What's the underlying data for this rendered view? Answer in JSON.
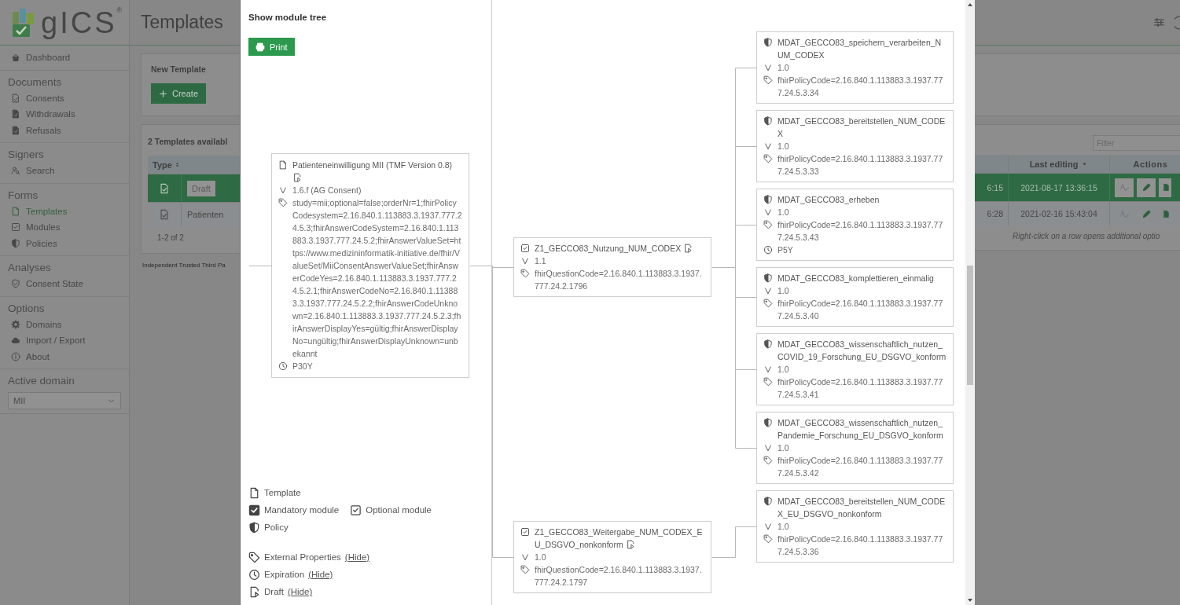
{
  "app": {
    "logo": "gICS$^{®}$",
    "page_title": "Templates"
  },
  "sidebar": {
    "sections": [
      {
        "items": [
          {
            "label": "Dashboard",
            "selected": false
          }
        ]
      },
      {
        "heading": "Documents",
        "items": [
          {
            "label": "Consents",
            "selected": false
          },
          {
            "label": "Withdrawals",
            "selected": false
          },
          {
            "label": "Refusals",
            "selected": false
          }
        ]
      },
      {
        "heading": "Signers",
        "items": [
          {
            "label": "Search",
            "selected": false
          }
        ]
      },
      {
        "heading": "Forms",
        "items": [
          {
            "label": "Templates",
            "selected": true
          },
          {
            "label": "Modules",
            "selected": false
          },
          {
            "label": "Policies",
            "selected": false
          }
        ]
      },
      {
        "heading": "Analyses",
        "items": [
          {
            "label": "Consent State",
            "selected": false
          }
        ]
      },
      {
        "heading": "Options",
        "items": [
          {
            "label": "Domains",
            "selected": false
          },
          {
            "label": "Import / Export",
            "selected": false
          },
          {
            "label": "About",
            "selected": false
          }
        ]
      },
      {
        "heading": "Active domain",
        "select": {
          "value": "MII"
        }
      }
    ]
  },
  "new_template": {
    "title": "New Template",
    "button": "Create"
  },
  "templates": {
    "title": "2 Templates availabl",
    "filter": {
      "placeholder": "Filter"
    },
    "columns": [
      "Type",
      "Last editing",
      "Actions"
    ],
    "rows": [
      {
        "selected": true,
        "badge": "Draft",
        "column_3": "6:15",
        "last_editing": "2021-08-17 13:36:15"
      },
      {
        "selected": false,
        "name": "Patienten",
        "column_3": "6:28",
        "last_editing": "2021-02-16 15:43:04"
      }
    ],
    "pagination": "1-2 of 2",
    "hint": "Right-click on a row opens additional optio"
  },
  "footer": "Independent Trusted Third Pa",
  "modal": {
    "title": "Show module tree",
    "print_button": "Print",
    "template": {
      "name": "Patienteneinwilligung MII (TMF Version 0.8)",
      "draft": true,
      "version": "1.6.f (AG Consent)",
      "properties": "study=mii;optional=false;orderNr=1;fhirPolicyCodesystem=2.16.840.1.113883.3.1937.777.24.5.3;fhirAnswerCodeSystem=2.16.840.1.113883.3.1937.777.24.5.2;fhirAnswerValueSet=https://www.medizininformatik-initiative.de/fhir/ValueSet/MiiConsentAnswerValueSet;fhirAnswerCodeYes=2.16.840.1.113883.3.1937.777.24.5.2.1;fhirAnswerCodeNo=2.16.840.1.113883.3.1937.777.24.5.2.2;fhirAnswerCodeUnknown=2.16.840.1.113883.3.1937.777.24.5.2.3;fhirAnswerDisplayYes=gültig;fhirAnswerDisplayNo=ungültig;fhirAnswerDisplayUnknown=unbekannt",
      "expiration": "P30Y"
    },
    "modules": [
      {
        "name": "Z1_GECCO83_Nutzung_NUM_CODEX",
        "mandatory": false,
        "draft": true,
        "version": "1.1",
        "properties": "fhirQuestionCode=2.16.840.1.113883.3.1937.777.24.2.1796",
        "policies": [
          {
            "name": "MDAT_GECCO83_speichern_verarbeiten_NUM_CODEX",
            "version": "1.0",
            "properties": "fhirPolicyCode=2.16.840.1.113883.3.1937.777.24.5.3.34"
          },
          {
            "name": "MDAT_GECCO83_bereitstellen_NUM_CODEX",
            "version": "1.0",
            "properties": "fhirPolicyCode=2.16.840.1.113883.3.1937.777.24.5.3.33"
          },
          {
            "name": "MDAT_GECCO83_erheben",
            "version": "1.0",
            "properties": "fhirPolicyCode=2.16.840.1.113883.3.1937.777.24.5.3.43",
            "expiration": "P5Y"
          },
          {
            "name": "MDAT_GECCO83_komplettieren_einmalig",
            "version": "1.0",
            "properties": "fhirPolicyCode=2.16.840.1.113883.3.1937.777.24.5.3.40"
          },
          {
            "name": "MDAT_GECCO83_wissenschaftlich_nutzen_COVID_19_Forschung_EU_DSGVO_konform",
            "version": "1.0",
            "properties": "fhirPolicyCode=2.16.840.1.113883.3.1937.777.24.5.3.41"
          },
          {
            "name": "MDAT_GECCO83_wissenschaftlich_nutzen_Pandemie_Forschung_EU_DSGVO_konform",
            "version": "1.0",
            "properties": "fhirPolicyCode=2.16.840.1.113883.3.1937.777.24.5.3.42"
          }
        ]
      },
      {
        "name": "Z1_GECCO83_Weitergabe_NUM_CODEX_EU_DSGVO_nonkonform",
        "mandatory": false,
        "draft": true,
        "version": "1.0",
        "properties": "fhirQuestionCode=2.16.840.1.113883.3.1937.777.24.2.1797",
        "policies": [
          {
            "name": "MDAT_GECCO83_bereitstellen_NUM_CODEX_EU_DSGVO_nonkonform",
            "version": "1.0",
            "properties": "fhirPolicyCode=2.16.840.1.113883.3.1937.777.24.5.3.36"
          }
        ]
      }
    ],
    "legend": {
      "rows": [
        [
          {
            "kind": "template",
            "label": "Template"
          }
        ],
        [
          {
            "kind": "mandatory",
            "label": "Mandatory module"
          },
          {
            "kind": "optional",
            "label": "Optional module"
          }
        ],
        [
          {
            "kind": "policy",
            "label": "Policy"
          }
        ]
      ],
      "toggles": [
        {
          "kind": "properties",
          "label": "External Properties",
          "link": "(Hide)"
        },
        {
          "kind": "expiration",
          "label": "Expiration",
          "link": "(Hide)"
        },
        {
          "kind": "draft",
          "label": "Draft",
          "link": "(Hide)"
        }
      ]
    }
  }
}
